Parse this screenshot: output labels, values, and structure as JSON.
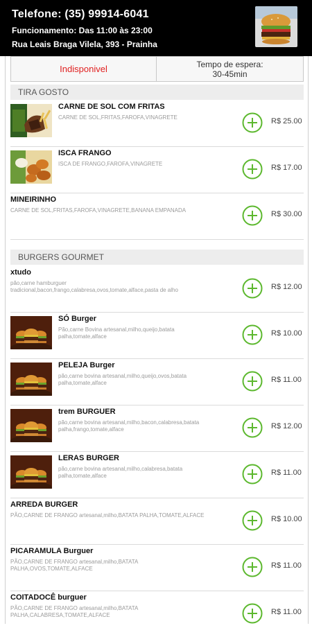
{
  "header": {
    "phone": "Telefone: (35) 99914-6041",
    "hours": "Funcionamento: Das 11:00 às 23:00",
    "address": "Rua Leais Braga Vilela, 393 - Prainha"
  },
  "status": {
    "availability": "Indisponivel",
    "wait_label": "Tempo de espera:",
    "wait_time": "30-45min"
  },
  "sections": [
    {
      "title": "TIRA GOSTO",
      "items": [
        {
          "name": "CARNE DE SOL COM FRITAS",
          "desc": "CARNE DE SOL,FRITAS,FAROFA,VINAGRETE",
          "price": "R$ 25.00",
          "image": "meat-fries-photo"
        },
        {
          "name": "ISCA FRANGO",
          "desc": "ISCA DE FRANGO,FAROFA,VINAGRETE",
          "price": "R$ 17.00",
          "image": "chicken-photo"
        },
        {
          "name": "MINEIRINHO",
          "desc": "CARNE DE SOL,FRITAS,FAROFA,VINAGRETE,BANANA EMPANADA",
          "price": "R$ 30.00",
          "image": ""
        }
      ]
    },
    {
      "title": "BURGERS GOURMET",
      "items": [
        {
          "name": "xtudo",
          "desc": "pão,carne hamburguer tradicional,bacon,frango,calabresa,ovos,tomate,alface,pasta de alho",
          "price": "R$ 12.00",
          "image": ""
        },
        {
          "name": "SÓ Burger",
          "desc": "Pão,carne Bovina artesanal,milho,queijo,batata palha,tomate,alface",
          "price": "R$ 10.00",
          "image": "burger-photo"
        },
        {
          "name": "PELEJA Burger",
          "desc": "pão,carne bovina artesanal,milho,queijo,ovos,batata palha,tomate,alface",
          "price": "R$ 11.00",
          "image": "burger-photo"
        },
        {
          "name": "trem BURGUER",
          "desc": "pão,carne bovina artesanal,milho,bacon,calabresa,batata palha,frango,tomate,alface",
          "price": "R$ 12.00",
          "image": "burger-photo"
        },
        {
          "name": "LERAS BURGER",
          "desc": "pão,carne bovina artesanal,milho,calabresa,batata palha,tomate,alface",
          "price": "R$ 11.00",
          "image": "burger-photo"
        },
        {
          "name": "ARREDA BURGER",
          "desc": "PÃO,CARNE DE FRANGO artesanal,milho,BATATA PALHA,TOMATE,ALFACE",
          "price": "R$ 10.00",
          "image": ""
        },
        {
          "name": "PICARAMULA Burguer",
          "desc": "PÃO,CARNE DE FRANGO artesanal,milho,BATATA PALHA,OVOS,TOMATE,ALFACE",
          "price": "R$ 11.00",
          "image": ""
        },
        {
          "name": "COITADOCÊ burguer",
          "desc": "PÃO,CARNE DE FRANGO artesanal,milho,BATATA PALHA,CALABRESA,TOMATE,ALFACE",
          "price": "R$ 11.00",
          "image": ""
        }
      ]
    }
  ],
  "colors": {
    "accent_green": "#5cb82e",
    "unavailable_red": "#e02020",
    "header_bg": "#000000"
  },
  "icons": {
    "add": "plus-circle-icon"
  }
}
